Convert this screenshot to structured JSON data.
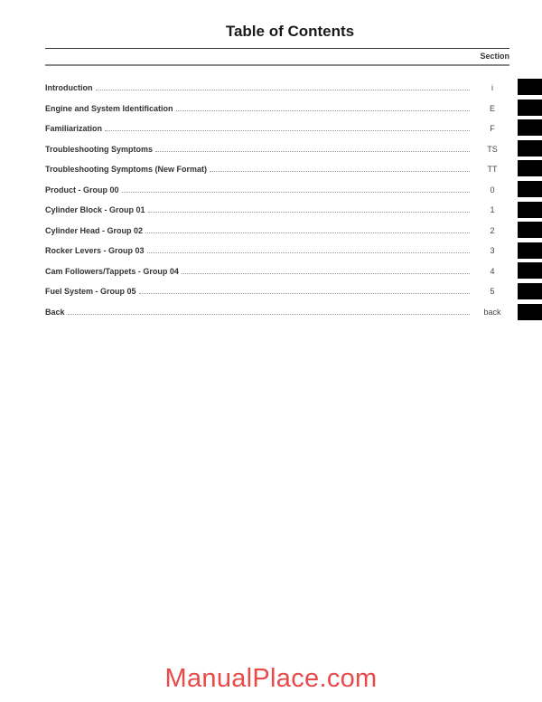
{
  "page": {
    "title": "Table of Contents",
    "section_header": "Section",
    "entries": [
      {
        "label": "Introduction",
        "section": "i"
      },
      {
        "label": "Engine and System Identification",
        "section": "E"
      },
      {
        "label": "Familiarization",
        "section": "F"
      },
      {
        "label": "Troubleshooting Symptoms",
        "section": "TS"
      },
      {
        "label": "Troubleshooting Symptoms (New Format)",
        "section": "TT"
      },
      {
        "label": "Product - Group 00",
        "section": "0"
      },
      {
        "label": "Cylinder Block - Group 01",
        "section": "1"
      },
      {
        "label": "Cylinder Head - Group 02",
        "section": "2"
      },
      {
        "label": "Rocker Levers - Group 03",
        "section": "3"
      },
      {
        "label": "Cam Followers/Tappets - Group 04",
        "section": "4"
      },
      {
        "label": "Fuel System - Group 05",
        "section": "5"
      },
      {
        "label": "Back",
        "section": "back"
      }
    ]
  },
  "watermark": {
    "text": "ManualPlace.com",
    "color": "#e84a4a"
  }
}
